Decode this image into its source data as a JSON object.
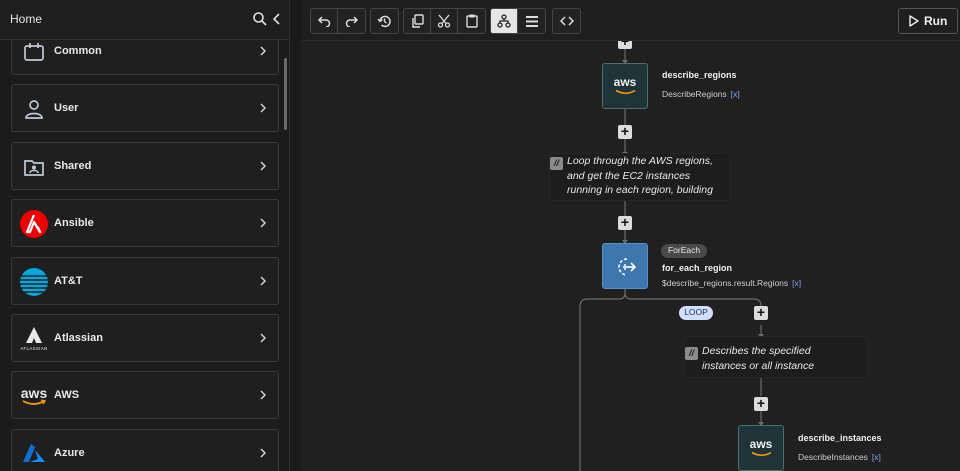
{
  "sidebar": {
    "title": "Home",
    "items": [
      {
        "label": "Common",
        "icon": "calendar-icon"
      },
      {
        "label": "User",
        "icon": "user-icon"
      },
      {
        "label": "Shared",
        "icon": "shared-folder-icon"
      },
      {
        "label": "Ansible",
        "icon": "ansible-logo"
      },
      {
        "label": "AT&T",
        "icon": "att-logo"
      },
      {
        "label": "Atlassian",
        "icon": "atlassian-logo",
        "logo_text": "ATLASSIAN"
      },
      {
        "label": "AWS",
        "icon": "aws-logo",
        "logo_text": "aws"
      },
      {
        "label": "Azure",
        "icon": "azure-logo"
      }
    ]
  },
  "toolbar": {
    "run_label": "Run"
  },
  "canvas": {
    "node1": {
      "title": "describe_regions",
      "sub": "DescribeRegions",
      "x": "[x]",
      "logo_text": "aws"
    },
    "note1": {
      "text": "Loop through the AWS regions,\nand get the EC2 instances\nrunning in each region, building"
    },
    "node2": {
      "badge": "ForEach",
      "title": "for_each_region",
      "sub": "$describe_regions.result.Regions",
      "x": "[x]"
    },
    "loop_badge": "LOOP",
    "note2": {
      "text": "Describes the specified\ninstances or all instance"
    },
    "node3": {
      "title": "describe_instances",
      "sub": "DescribeInstances",
      "x": "[x]",
      "logo_text": "aws"
    }
  },
  "colors": {
    "aws_orange": "#ff9900",
    "ansible_red": "#e00",
    "att_blue": "#00a8e0",
    "azure_blue": "#0a6fd6",
    "foreach_node": "#3d77ad",
    "variable_blue": "#7ea7ff"
  }
}
